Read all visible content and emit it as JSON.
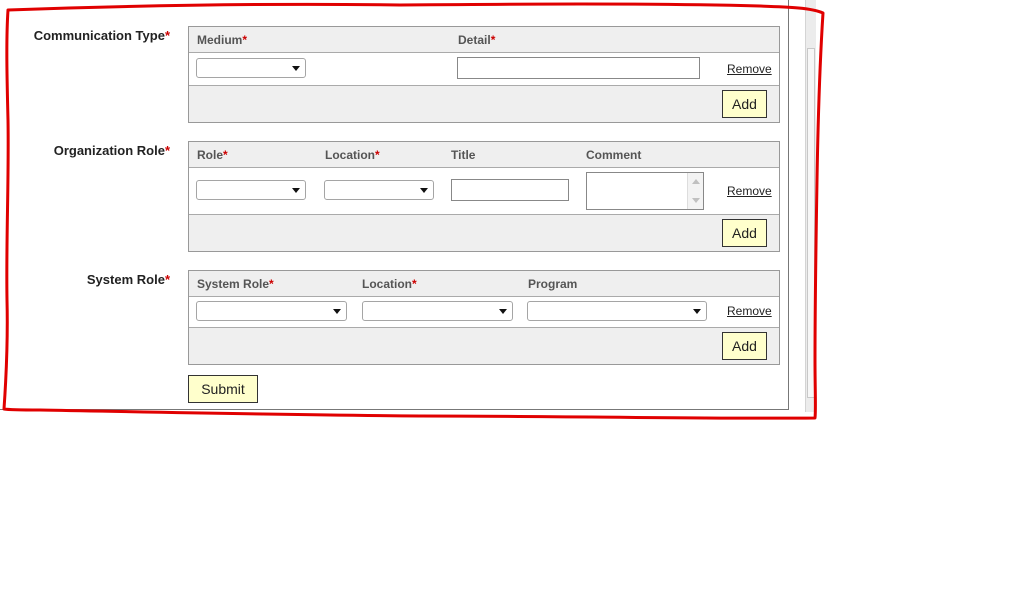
{
  "required_marker": "*",
  "communication": {
    "label": "Communication Type",
    "columns": {
      "medium": "Medium",
      "detail": "Detail"
    },
    "medium_value": "",
    "detail_value": "",
    "remove": "Remove",
    "add": "Add"
  },
  "organization": {
    "label": "Organization Role",
    "columns": {
      "role": "Role",
      "location": "Location",
      "title": "Title",
      "comment": "Comment"
    },
    "role_value": "",
    "location_value": "",
    "title_value": "",
    "comment_value": "",
    "remove": "Remove",
    "add": "Add"
  },
  "system": {
    "label": "System Role",
    "columns": {
      "system_role": "System Role",
      "location": "Location",
      "program": "Program"
    },
    "system_role_value": "",
    "location_value": "",
    "program_value": "",
    "remove": "Remove",
    "add": "Add"
  },
  "submit": "Submit",
  "colors": {
    "annotation": "#e00000",
    "required": "#cc0000",
    "button_bg": "#ffffcc",
    "header_bg": "#efefef"
  }
}
